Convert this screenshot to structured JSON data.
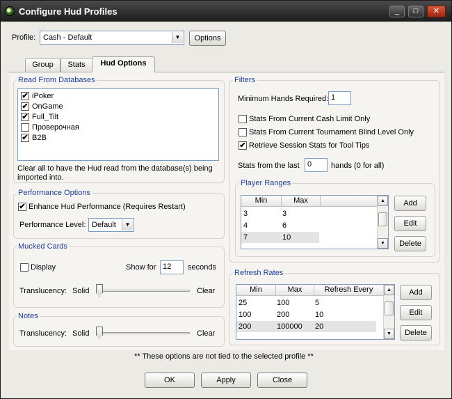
{
  "window": {
    "title": "Configure Hud Profiles",
    "btn_min": "_",
    "btn_max": "□",
    "btn_close": "✕"
  },
  "profile": {
    "label": "Profile:",
    "value": "Cash - Default",
    "options_btn": "Options"
  },
  "tabs": [
    {
      "label": "Group",
      "active": false
    },
    {
      "label": "Stats",
      "active": false
    },
    {
      "label": "Hud Options",
      "active": true
    }
  ],
  "read_from_db": {
    "title": "Read From Databases",
    "items": [
      {
        "label": "iPoker",
        "checked": true
      },
      {
        "label": "OnGame",
        "checked": true
      },
      {
        "label": "Full_Tilt",
        "checked": true
      },
      {
        "label": "Проверочная",
        "checked": false
      },
      {
        "label": "B2B",
        "checked": true
      }
    ],
    "note_line1": "Clear all to have the Hud read from the database(s) being",
    "note_line2": "imported into."
  },
  "performance": {
    "title": "Performance Options",
    "enhance_label": "Enhance Hud Performance (Requires Restart)",
    "enhance_checked": true,
    "level_label": "Performance Level:",
    "level_value": "Default"
  },
  "mucked": {
    "title": "Mucked Cards",
    "display_label": "Display",
    "display_checked": false,
    "show_for_label": "Show for",
    "show_for_value": "12",
    "seconds_label": "seconds",
    "translucency_label": "Translucency:",
    "solid_label": "Solid",
    "clear_label": "Clear",
    "translucency_value": 0
  },
  "notes": {
    "title": "Notes",
    "translucency_label": "Translucency:",
    "solid_label": "Solid",
    "clear_label": "Clear",
    "translucency_value": 0
  },
  "filters": {
    "title": "Filters",
    "min_hands_label": "Minimum Hands Required:",
    "min_hands_value": "1",
    "cash_limit_label": "Stats From Current Cash Limit Only",
    "cash_limit_checked": false,
    "tourn_blind_label": "Stats From Current Tournament Blind Level Only",
    "tourn_blind_checked": false,
    "session_label": "Retrieve Session Stats for Tool Tips",
    "session_checked": true,
    "last_label": "Stats from the last",
    "last_value": "0",
    "hands_label": "hands (0 for all)"
  },
  "player_ranges": {
    "title": "Player Ranges",
    "columns": [
      "Min",
      "Max"
    ],
    "rows": [
      [
        "3",
        "3"
      ],
      [
        "4",
        "6"
      ],
      [
        "7",
        "10"
      ]
    ],
    "add": "Add",
    "edit": "Edit",
    "delete": "Delete"
  },
  "refresh_rates": {
    "title": "Refresh Rates",
    "columns": [
      "Min",
      "Max",
      "Refresh Every"
    ],
    "rows": [
      [
        "25",
        "100",
        "5"
      ],
      [
        "100",
        "200",
        "10"
      ],
      [
        "200",
        "100000",
        "20"
      ]
    ],
    "add": "Add",
    "edit": "Edit",
    "delete": "Delete"
  },
  "footer_note": "** These options are not tied to the selected profile **",
  "buttons": {
    "ok": "OK",
    "apply": "Apply",
    "close": "Close"
  }
}
